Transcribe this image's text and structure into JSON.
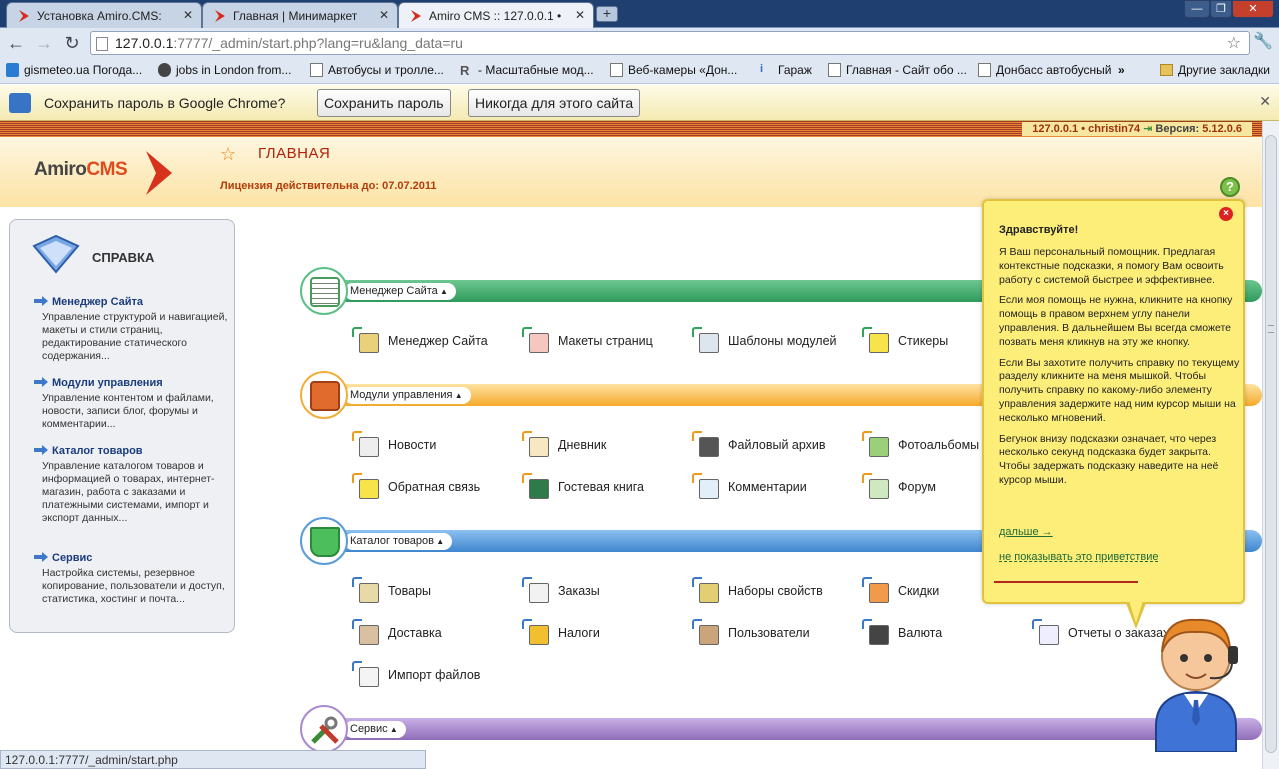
{
  "browser": {
    "tabs": [
      {
        "title": "Установка Amiro.CMS:",
        "active": false
      },
      {
        "title": "Главная | Минимаркет",
        "active": false
      },
      {
        "title": "Amiro CMS :: 127.0.0.1 •",
        "active": true
      }
    ],
    "newtab_label": "+",
    "window_buttons": [
      "—",
      "❐",
      "✕"
    ],
    "url_host": "127.0.0.1",
    "url_rest": ":7777/_admin/start.php?lang=ru&lang_data=ru",
    "bookmarks": [
      "gismeteo.ua Погода...",
      "jobs in London from...",
      "Автобусы и тролле...",
      "- Масштабные мод...",
      "Веб-камеры «Дон...",
      "Гараж",
      "Главная - Сайт обо ...",
      "Донбасс автобусный"
    ],
    "bookmarks_more": "»",
    "other_bookmarks": "Другие закладки",
    "infobar": {
      "text": "Сохранить пароль в Google Chrome?",
      "save_button": "Сохранить пароль",
      "never_button": "Никогда для этого сайта",
      "close": "✕"
    },
    "status_url": "127.0.0.1:7777/_admin/start.php"
  },
  "cms": {
    "host": "127.0.0.1",
    "sep": "•",
    "user": "christin74",
    "version_label": "Версия:",
    "version": "5.12.0.6",
    "logo_main": "Amiro",
    "logo_cms": "CMS",
    "page_title": "ГЛАВНАЯ",
    "license": "Лицензия действительна до: 07.07.2011",
    "help_glyph": "?"
  },
  "sidebar": {
    "title": "СПРАВКА",
    "sections": [
      {
        "link": "Менеджер Сайта",
        "desc": "Управление структурой и навигацией, макеты и стили страниц, редактирование статического содержания..."
      },
      {
        "link": "Модули управления",
        "desc": "Управление контентом и файлами, новости, записи блог, форумы и комментарии..."
      },
      {
        "link": "Каталог товаров",
        "desc": "Управление каталогом товаров и информацией о товарах, интернет-магазин, работа с заказами и платежными системами, импорт и экспорт данных..."
      },
      {
        "link": "Сервис",
        "desc": "Настройка системы, резервное копирование, пользователи и доступ, статистика, хостинг и почта..."
      }
    ]
  },
  "groups": {
    "site_manager": {
      "label": "Менеджер Сайта",
      "items": [
        "Менеджер Сайта",
        "Макеты страниц",
        "Шаблоны модулей",
        "Стикеры"
      ]
    },
    "modules": {
      "label": "Модули управления",
      "items": [
        "Новости",
        "Дневник",
        "Файловый архив",
        "Фотоальбомы",
        "Обратная связь",
        "Гостевая книга",
        "Комментарии",
        "Форум"
      ]
    },
    "catalog": {
      "label": "Каталог товаров",
      "items": [
        "Товары",
        "Заказы",
        "Наборы свойств",
        "Скидки",
        "Доставка",
        "Налоги",
        "Пользователи",
        "Валюта",
        "Отчеты о заказах",
        "Импорт файлов"
      ]
    },
    "service": {
      "label": "Сервис"
    }
  },
  "assistant": {
    "close": "×",
    "title": "Здравствуйте!",
    "paragraphs": [
      "Я Ваш персональный помощник. Предлагая контекстные подсказки, я помогу Вам освоить работу с системой быстрее и эффективнее.",
      "Если моя помощь не нужна, кликните на кнопку помощь в правом верхнем углу панели управления. В дальнейшем Вы всегда сможете позвать меня кликнув на эту же кнопку.",
      "Если Вы захотите получить справку по текущему разделу кликните на меня мышкой. Чтобы получить справку по какому-либо элементу управления задержите над ним курсор мыши на несколько мгновений.",
      "Бегунок внизу подсказки означает, что через несколько секунд подсказка будет закрыта. Чтобы задержать подсказку наведите на неё курсор мыши."
    ],
    "more_link": "дальше →",
    "no_show_link": "не показывать это приветствие"
  },
  "colors": {
    "green_bar": "#3ea56a",
    "orange_bar": "#f4a92a",
    "blue_bar": "#3f86cf",
    "purple_bar": "#8f6db8",
    "accent_red": "#b3210a"
  }
}
